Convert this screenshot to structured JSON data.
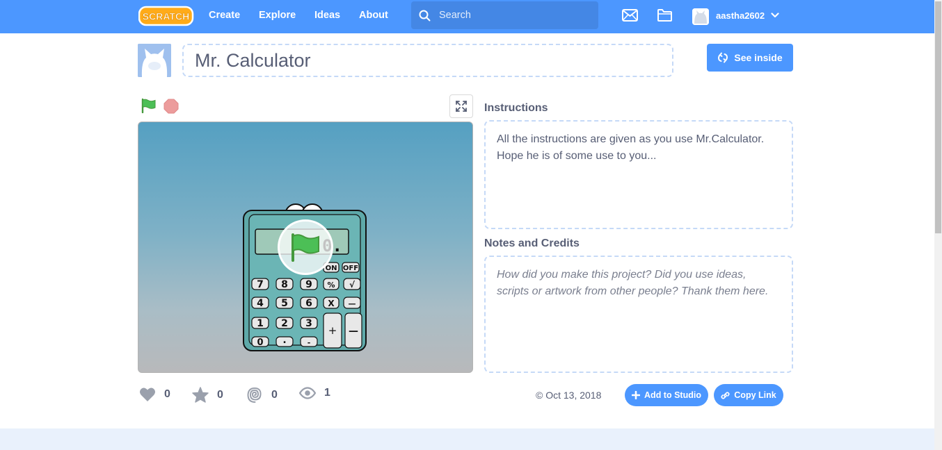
{
  "navbar": {
    "logo_text": "SCRATCH",
    "links": [
      "Create",
      "Explore",
      "Ideas",
      "About"
    ],
    "search_placeholder": "Search",
    "username": "aastha2602"
  },
  "project": {
    "title": "Mr. Calculator",
    "see_inside_label": "See inside"
  },
  "instructions": {
    "heading": "Instructions",
    "text": "All the instructions are given as you use Mr.Calculator. Hope he is of some use to you..."
  },
  "notes": {
    "heading": "Notes and Credits",
    "placeholder": "How did you make this project? Did you use ideas, scripts or artwork from other people? Thank them here."
  },
  "stats": {
    "loves": "0",
    "favorites": "0",
    "remixes": "0",
    "views": "1"
  },
  "share_date": "© Oct 13, 2018",
  "buttons": {
    "add_to_studio": "Add to Studio",
    "copy_link": "Copy Link"
  },
  "calculator_display": "0.",
  "calculator_keys": [
    "ON",
    "OFF",
    "7",
    "8",
    "9",
    "%",
    "√",
    "4",
    "5",
    "6",
    "X",
    "—",
    "1",
    "2",
    "3",
    "+",
    "—",
    "0",
    ".",
    "-"
  ],
  "colors": {
    "brand_blue": "#4c97ff",
    "flag_green": "#4cbf56",
    "stop_red": "#ec9c9c"
  },
  "icons": [
    "search-icon",
    "mail-icon",
    "folder-icon",
    "chevron-down-icon",
    "green-flag-icon",
    "stop-icon",
    "fullscreen-icon",
    "remix-icon",
    "heart-icon",
    "star-icon",
    "spiral-icon",
    "eye-icon",
    "plus-icon",
    "link-icon"
  ]
}
